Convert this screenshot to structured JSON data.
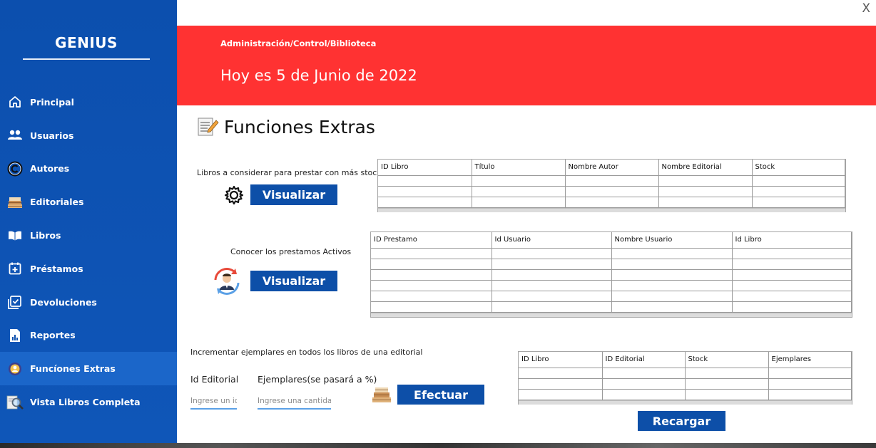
{
  "sidebar": {
    "brand": "GENIUS",
    "items": [
      {
        "label": "Principal",
        "icon": "home-icon"
      },
      {
        "label": "Usuarios",
        "icon": "users-icon"
      },
      {
        "label": "Autores",
        "icon": "copyright-icon"
      },
      {
        "label": "Editoriales",
        "icon": "books-stack-icon"
      },
      {
        "label": "Libros",
        "icon": "open-book-icon"
      },
      {
        "label": "Préstamos",
        "icon": "calendar-plus-icon"
      },
      {
        "label": "Devoluciones",
        "icon": "calendar-check-icon"
      },
      {
        "label": "Reportes",
        "icon": "report-icon"
      },
      {
        "label": "Funcíones Extras",
        "icon": "extras-icon",
        "active": true
      },
      {
        "label": "Vista Libros Completa",
        "icon": "magnifier-book-icon"
      }
    ]
  },
  "window": {
    "close_label": "X"
  },
  "header": {
    "breadcrumb": "Administración/Control/Biblioteca",
    "date": "Hoy es 5 de Junio de 2022"
  },
  "page": {
    "title": "Funciones Extras"
  },
  "section1": {
    "caption": "Libros a considerar para prestar con más stock",
    "button": "Visualizar",
    "columns": [
      "ID Libro",
      "Título",
      "Nombre Autor",
      "Nombre Editorial",
      "Stock"
    ]
  },
  "section2": {
    "caption": "Conocer los prestamos Activos",
    "button": "Visualizar",
    "columns": [
      "ID Prestamo",
      "Id Usuario",
      "Nombre Usuario",
      "Id Libro"
    ]
  },
  "section3": {
    "caption": "Incrementar ejemplares en todos los libros de una editorial",
    "editorial_label": "Id Editorial",
    "editorial_placeholder": "Ingrese un id",
    "ejemplares_label": "Ejemplares(se pasará a %)",
    "ejemplares_placeholder": "Ingrese una cantidad",
    "button": "Efectuar",
    "columns": [
      "ID Libro",
      "ID Editorial",
      "Stock",
      "Ejemplares"
    ],
    "reload_button": "Recargar"
  },
  "colors": {
    "sidebar": "#0c4fae",
    "active_item": "#1b66c9",
    "header": "#ff3232",
    "button": "#0d4fa8"
  }
}
